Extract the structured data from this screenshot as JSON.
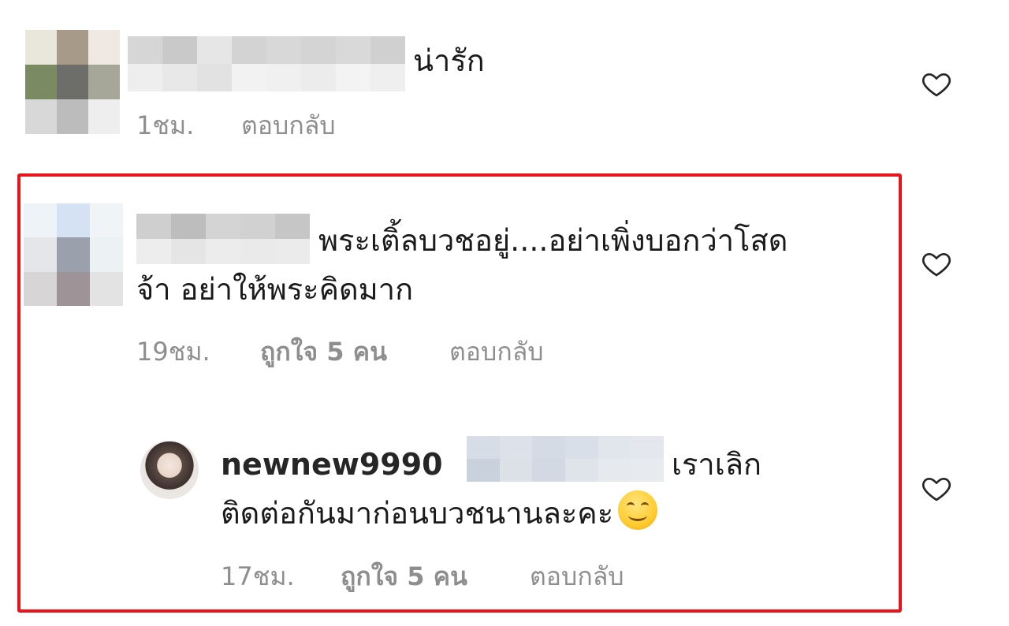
{
  "comments": [
    {
      "text": "น่ารัก",
      "time": "1ชม.",
      "reply_label": "ตอบกลับ"
    },
    {
      "text_line1": "พระเติ้ลบวชอยู่....อย่าเพิ่งบอกว่าโสด",
      "text_line2": "จ้า  อย่าให้พระคิดมาก",
      "time": "19ชม.",
      "likes": "ถูกใจ 5 คน",
      "reply_label": "ตอบกลับ",
      "reply": {
        "username": "newnew9990",
        "text_line1": "เราเลิก",
        "text_line2": "ติดต่อกันมาก่อนบวชนานละคะ",
        "time": "17ชม.",
        "likes": "ถูกใจ 5 คน",
        "reply_label": "ตอบกลับ"
      }
    }
  ],
  "icons": {
    "like": "heart-outline-icon",
    "emoji": "smiling-face-emoji"
  },
  "colors": {
    "highlight": "#e8141c",
    "meta_text": "#8e8e8e"
  }
}
